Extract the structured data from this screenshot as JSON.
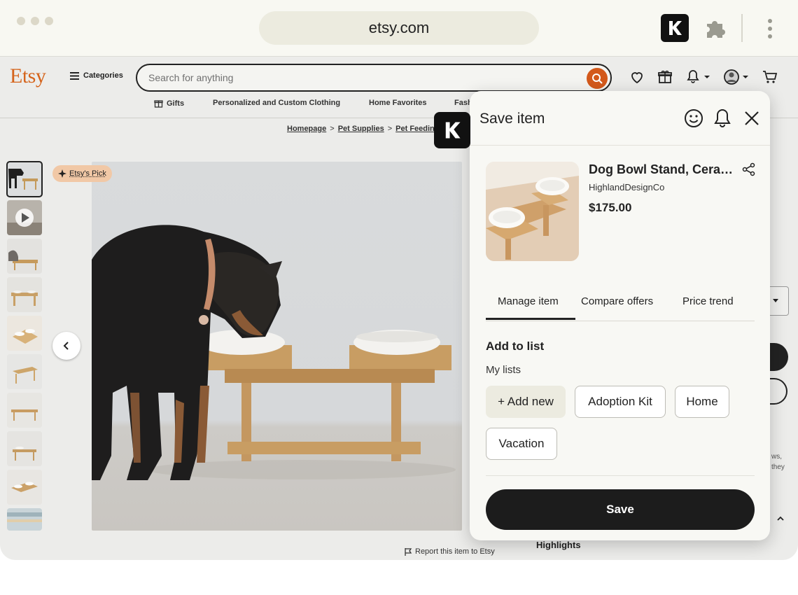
{
  "browser": {
    "url": "etsy.com",
    "extension_icon": "kinda-k-icon",
    "colors": {
      "chrome_bg": "#f8f8f2",
      "url_bg": "#ecebdf"
    }
  },
  "etsy": {
    "logo": "Etsy",
    "categories_label": "Categories",
    "search_placeholder": "Search for anything",
    "accent": "#d3591b",
    "nav": [
      "Gifts",
      "Personalized and Custom Clothing",
      "Home Favorites",
      "Fash"
    ],
    "breadcrumb": [
      "Homepage",
      "Pet Supplies",
      "Pet Feedin"
    ],
    "badge": "Etsy's Pick",
    "report_label": "Report this item to Etsy",
    "highlights_label": "Highlights",
    "side_text": [
      "ws,",
      "they"
    ]
  },
  "panel": {
    "title": "Save item",
    "product": {
      "name": "Dog Bowl Stand, Ceramic Bowls",
      "shop": "HighlandDesignCo",
      "price": "$175.00"
    },
    "tabs": [
      "Manage item",
      "Compare offers",
      "Price trend"
    ],
    "active_tab": "Manage item",
    "add_to_list_title": "Add to list",
    "my_lists_label": "My lists",
    "lists": [
      "+ Add new",
      "Adoption Kit",
      "Home",
      "Vacation"
    ],
    "save_label": "Save"
  }
}
